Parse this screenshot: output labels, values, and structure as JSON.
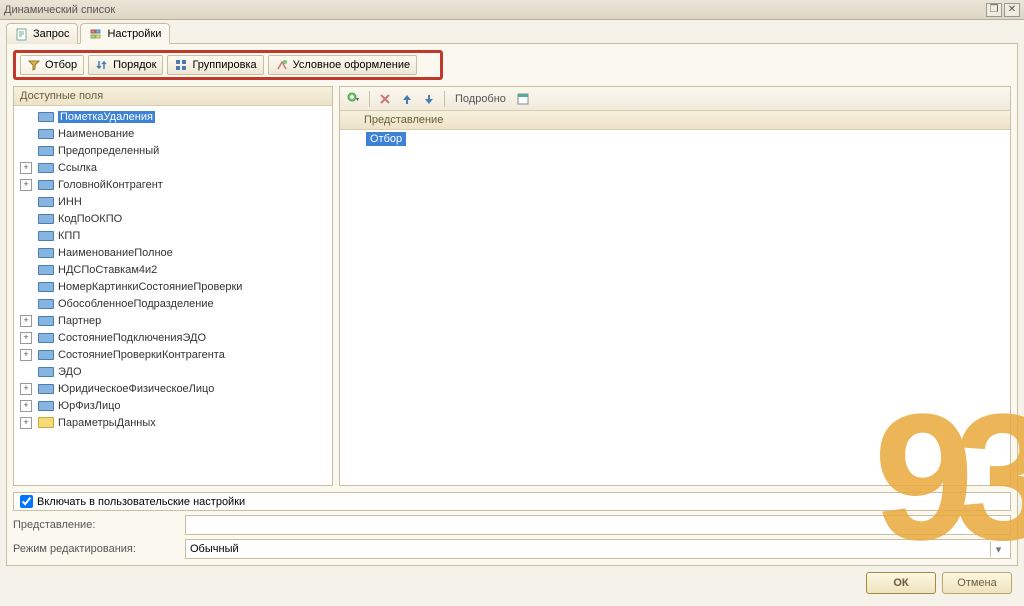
{
  "window": {
    "title": "Динамический список"
  },
  "mainTabs": {
    "query": "Запрос",
    "settings": "Настройки"
  },
  "subTabs": {
    "filter": "Отбор",
    "order": "Порядок",
    "grouping": "Группировка",
    "conditional": "Условное оформление"
  },
  "leftPanel": {
    "header": "Доступные поля"
  },
  "fields": [
    {
      "label": "ПометкаУдаления",
      "expandable": false,
      "selected": true
    },
    {
      "label": "Наименование",
      "expandable": false
    },
    {
      "label": "Предопределенный",
      "expandable": false
    },
    {
      "label": "Ссылка",
      "expandable": true
    },
    {
      "label": "ГоловнойКонтрагент",
      "expandable": true
    },
    {
      "label": "ИНН",
      "expandable": false
    },
    {
      "label": "КодПоОКПО",
      "expandable": false
    },
    {
      "label": "КПП",
      "expandable": false
    },
    {
      "label": "НаименованиеПолное",
      "expandable": false
    },
    {
      "label": "НДСПоСтавкам4и2",
      "expandable": false
    },
    {
      "label": "НомерКартинкиСостояниеПроверки",
      "expandable": false
    },
    {
      "label": "ОбособленноеПодразделение",
      "expandable": false
    },
    {
      "label": "Партнер",
      "expandable": true
    },
    {
      "label": "СостояниеПодключенияЭДО",
      "expandable": true
    },
    {
      "label": "СостояниеПроверкиКонтрагента",
      "expandable": true
    },
    {
      "label": "ЭДО",
      "expandable": false
    },
    {
      "label": "ЮридическоеФизическоеЛицо",
      "expandable": true
    },
    {
      "label": "ЮрФизЛицо",
      "expandable": true
    },
    {
      "label": "ПараметрыДанных",
      "expandable": true,
      "folder": true
    }
  ],
  "rightPanel": {
    "toolbar": {
      "details": "Подробно"
    },
    "columnHeader": "Представление",
    "rows": [
      {
        "label": "Отбор",
        "selected": true
      }
    ]
  },
  "bottom": {
    "includeUser": "Включать в пользовательские настройки",
    "presentation": "Представление:",
    "presentationValue": "",
    "editMode": "Режим редактирования:",
    "editModeValue": "Обычный"
  },
  "buttons": {
    "ok": "ОК",
    "cancel": "Отмена"
  },
  "watermark": "93"
}
